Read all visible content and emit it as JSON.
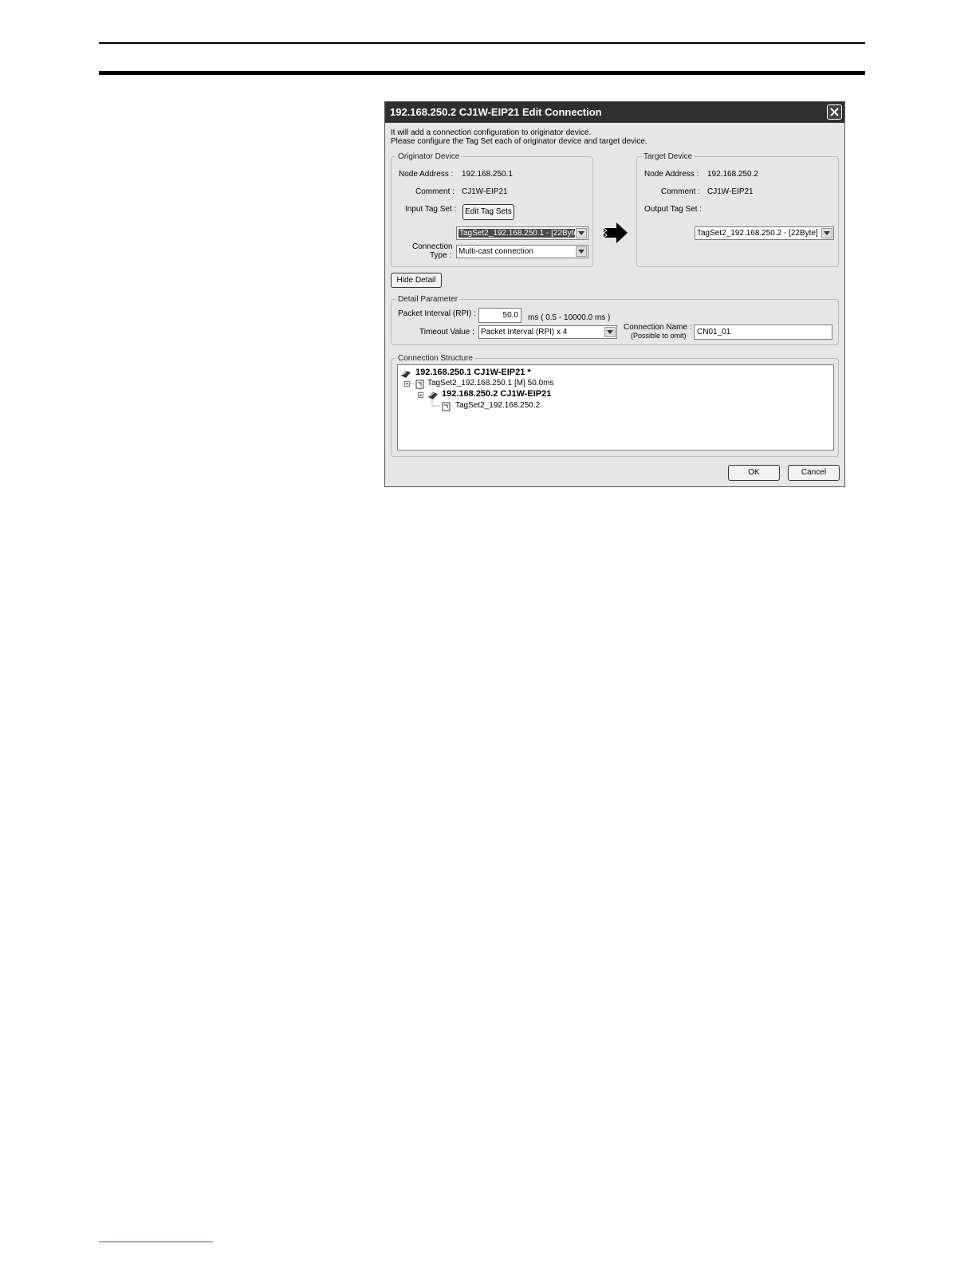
{
  "dialog": {
    "title": "192.168.250.2 CJ1W-EIP21 Edit Connection",
    "intro_line1": "It will add a connection configuration to originator device.",
    "intro_line2": "Please configure the Tag Set each of originator device and target device."
  },
  "originator": {
    "legend": "Originator Device",
    "node_address_label": "Node Address :",
    "node_address": "192.168.250.1",
    "comment_label": "Comment :",
    "comment": "CJ1W-EIP21",
    "input_tag_set_label": "Input Tag Set :",
    "edit_tag_sets_button": "Edit Tag Sets",
    "input_tag_set_value": "TagSet2_192.168.250.1 - [22Byte",
    "connection_type_label_1": "Connection",
    "connection_type_label_2": "Type :",
    "connection_type_value": "Multi-cast connection"
  },
  "target": {
    "legend": "Target Device",
    "node_address_label": "Node Address :",
    "node_address": "192.168.250.2",
    "comment_label": "Comment :",
    "comment": "CJ1W-EIP21",
    "output_tag_set_label": "Output Tag Set :",
    "output_tag_set_value": "TagSet2_192.168.250.2 - [22Byte]"
  },
  "hide_detail_button": "Hide Detail",
  "detail": {
    "legend": "Detail Parameter",
    "packet_interval_label": "Packet Interval (RPI) :",
    "packet_interval_value": "50.0",
    "packet_interval_range": "ms ( 0.5 - 10000.0 ms )",
    "timeout_label": "Timeout Value :",
    "timeout_value": "Packet Interval (RPI) x 4",
    "connection_name_label_1": "Connection Name :",
    "connection_name_label_2": "(Possible to omit)",
    "connection_name_value": "CN01_01"
  },
  "structure": {
    "legend": "Connection Structure",
    "rows": [
      "192.168.250.1 CJ1W-EIP21 *",
      "TagSet2_192.168.250.1 [M] 50.0ms",
      "192.168.250.2 CJ1W-EIP21",
      "TagSet2_192.168.250.2"
    ]
  },
  "buttons": {
    "ok": "OK",
    "cancel": "Cancel"
  }
}
